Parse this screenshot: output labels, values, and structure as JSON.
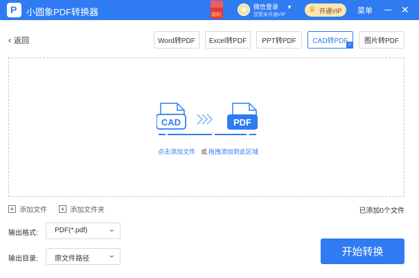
{
  "app": {
    "logo_letter": "P",
    "title": "小圆象PDF转换器"
  },
  "titlebar": {
    "gift_label": "福利",
    "login_title": "微信登录",
    "login_subtitle": "您暂未开通VIP",
    "vip_button": "开通VIP",
    "menu": "菜单"
  },
  "toolbar": {
    "back": "返回",
    "tabs": [
      "Word转PDF",
      "Excel转PDF",
      "PPT转PDF",
      "CAD转PDF",
      "图片转PDF"
    ],
    "active_tab": "CAD转PDF"
  },
  "dropzone": {
    "source_format": "CAD",
    "target_format": "PDF",
    "click_hint": "点击添加文件",
    "or": "或",
    "drag_hint": "拖拽添加到此区域"
  },
  "file_actions": {
    "add_file": "添加文件",
    "add_folder": "添加文件夹",
    "file_count": "已添加0个文件"
  },
  "output": {
    "format_label": "输出格式:",
    "format_value": "PDF(*.pdf)",
    "dir_label": "输出目录:",
    "dir_value": "原文件路径"
  },
  "start_button": "开始转换",
  "colors": {
    "accent": "#2f7bf2",
    "vip_bg": "#fbe6b4",
    "gift": "#e8373a"
  }
}
